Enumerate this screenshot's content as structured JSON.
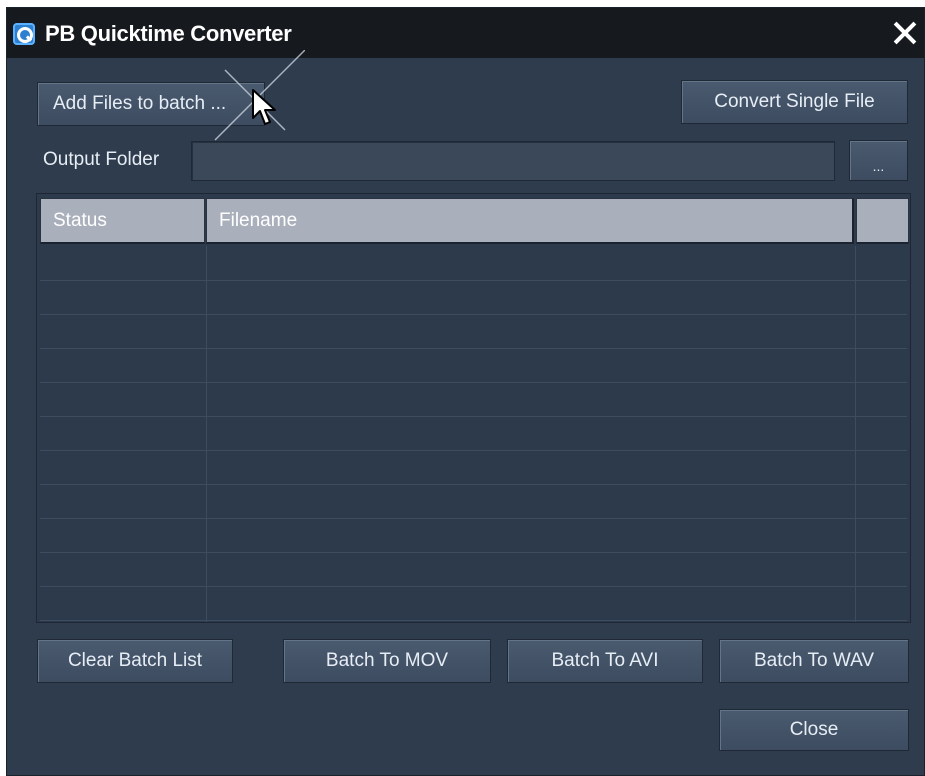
{
  "window": {
    "title": "PB Quicktime Converter",
    "app_icon": "quicktime-icon",
    "close_icon": "close-icon"
  },
  "toolbar": {
    "add_files_label": "Add Files to batch ...",
    "convert_single_label": "Convert Single File"
  },
  "output": {
    "label": "Output Folder",
    "value": "",
    "browse_label": "..."
  },
  "table": {
    "columns": [
      "Status",
      "Filename",
      ""
    ],
    "rows": []
  },
  "actions": {
    "clear_label": "Clear Batch List",
    "mov_label": "Batch To MOV",
    "avi_label": "Batch To AVI",
    "wav_label": "Batch To WAV",
    "close_label": "Close"
  },
  "colors": {
    "window_bg": "#2f3c4d",
    "titlebar_bg": "#16191e",
    "header_bg": "#a9b0bc",
    "text": "#e6edf5"
  }
}
